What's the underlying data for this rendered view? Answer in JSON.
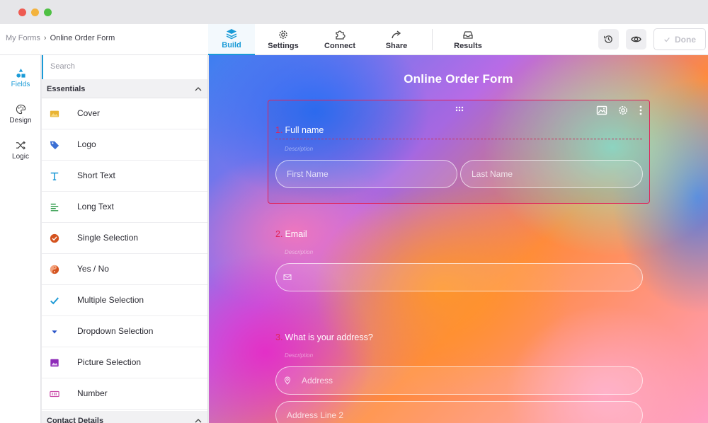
{
  "breadcrumb": {
    "parent": "My Forms",
    "separator": "›",
    "current": "Online Order Form"
  },
  "topnav": [
    {
      "label": "Build",
      "icon": "layers-icon",
      "active": true
    },
    {
      "label": "Settings",
      "icon": "gear-icon"
    },
    {
      "label": "Connect",
      "icon": "puzzle-icon"
    },
    {
      "label": "Share",
      "icon": "share-arrow-icon"
    },
    {
      "label": "Results",
      "icon": "inbox-icon"
    }
  ],
  "toolbar": {
    "history_icon": "history-icon",
    "preview_icon": "eye-icon",
    "done_label": "Done"
  },
  "rail": [
    {
      "label": "Fields",
      "icon": "shapes-icon",
      "active": true
    },
    {
      "label": "Design",
      "icon": "palette-icon"
    },
    {
      "label": "Logic",
      "icon": "shuffle-icon"
    }
  ],
  "fields_panel": {
    "search_placeholder": "Search",
    "sections": [
      {
        "title": "Essentials",
        "items": [
          {
            "label": "Cover",
            "icon": "cover-image-icon",
            "color": "#e9b434"
          },
          {
            "label": "Logo",
            "icon": "tag-icon",
            "color": "#3b6fd4"
          },
          {
            "label": "Short Text",
            "icon": "text-t-icon",
            "color": "#1f9ad6"
          },
          {
            "label": "Long Text",
            "icon": "paragraph-lines-icon",
            "color": "#2e9b4a"
          },
          {
            "label": "Single Selection",
            "icon": "check-circle-icon",
            "color": "#d4531f"
          },
          {
            "label": "Yes / No",
            "icon": "yin-yang-icon",
            "color": "#d4531f"
          },
          {
            "label": "Multiple Selection",
            "icon": "checkmark-icon",
            "color": "#1f9ad6"
          },
          {
            "label": "Dropdown Selection",
            "icon": "caret-down-icon",
            "color": "#2c56c9"
          },
          {
            "label": "Picture Selection",
            "icon": "picture-icon",
            "color": "#8e2bb8"
          },
          {
            "label": "Number",
            "icon": "number-box-icon",
            "color": "#c94aa8"
          }
        ]
      },
      {
        "title": "Contact Details",
        "items": []
      }
    ]
  },
  "form": {
    "title": "Online Order Form",
    "questions": [
      {
        "number": "1.",
        "label": "Full name",
        "description": "Description",
        "placeholders": [
          "First Name",
          "Last Name"
        ]
      },
      {
        "number": "2.",
        "label": "Email",
        "description": "Description",
        "placeholders": [
          ""
        ]
      },
      {
        "number": "3.",
        "label": "What is your address?",
        "description": "Description",
        "placeholders": [
          "Address",
          "Address Line 2"
        ]
      }
    ]
  },
  "colors": {
    "accent": "#1a9bd7",
    "selection": "#e0245a"
  }
}
